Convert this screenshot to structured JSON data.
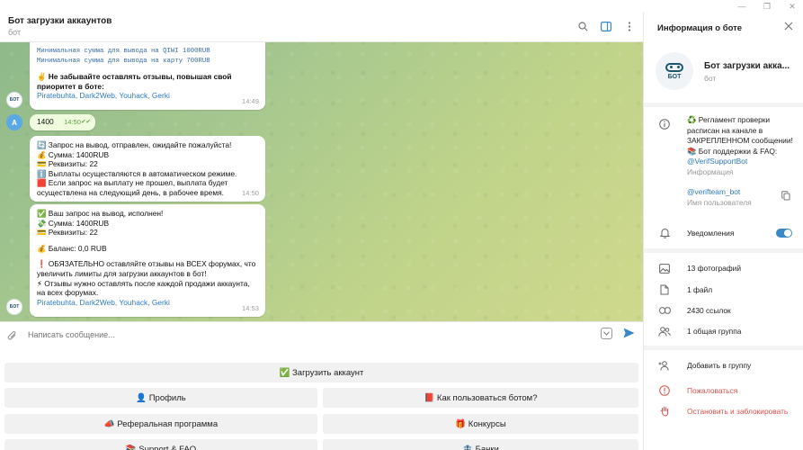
{
  "window": {
    "min": "—",
    "restore": "❐",
    "close": "✕"
  },
  "chat": {
    "title": "Бот загрузки аккаунтов",
    "subtitle": "бот"
  },
  "messages": [
    {
      "id": "m1",
      "lines": [
        {
          "t": "Минимальная сумма для вывода на QIWI 1000RUB",
          "cls": "mono"
        },
        {
          "t": "Минимальная сумма для вывода на карту 700RUB",
          "cls": "mono"
        },
        {
          "t": "",
          "cls": "gap"
        },
        {
          "t": "✌️ Не забывайте оставлять отзывы, повышая свой",
          "cls": "b"
        },
        {
          "t": "приоритет в боте:",
          "cls": "b"
        },
        {
          "t": "Piratebuhta, Dark2Web, Youhack, Gerki",
          "cls": "lnk"
        }
      ],
      "time": "14:49"
    },
    {
      "id": "m2",
      "text": "1400",
      "time": "14:50",
      "check": "✔✔"
    },
    {
      "id": "m3",
      "lines": [
        {
          "t": "🔄 Запрос на вывод,  отправлен, ожидайте пожалуйста!",
          "cls": ""
        },
        {
          "t": "💰 Сумма: 1400RUB",
          "cls": ""
        },
        {
          "t": "💳 Реквизиты: 22",
          "cls": ""
        },
        {
          "t": "ℹ️ Выплаты осуществляются в автоматическом режиме.",
          "cls": ""
        },
        {
          "t": "🟥 Если запрос на выплату не прошел, выплата будет",
          "cls": ""
        },
        {
          "t": "осуществлена на следующий день, в рабочее время.",
          "cls": ""
        }
      ],
      "time": "14:50"
    },
    {
      "id": "m4",
      "lines": [
        {
          "t": "✅ Ваш запрос на вывод, исполнен!",
          "cls": ""
        },
        {
          "t": "💸 Сумма: 1400RUB",
          "cls": ""
        },
        {
          "t": "💳 Реквизиты: 22",
          "cls": ""
        },
        {
          "t": "",
          "cls": "gap"
        },
        {
          "t": "💰 Баланс: 0,0 RUB",
          "cls": ""
        },
        {
          "t": "",
          "cls": "gap"
        },
        {
          "t": "❗ ОБЯЗАТЕЛЬНО оставляйте отзывы на ВСЕХ форумах, что бы",
          "cls": ""
        },
        {
          "t": "увеличить лимиты для загрузки аккаунтов в бот!",
          "cls": ""
        },
        {
          "t": "⚡ Отзывы нужно оставлять после каждой продажи аккаунта,",
          "cls": ""
        },
        {
          "t": "на всех форумах.",
          "cls": ""
        },
        {
          "t": "Piratebuhta, Dark2Web, Youhack, Gerki",
          "cls": "lnk"
        }
      ],
      "time": "14:53"
    }
  ],
  "avatars": {
    "bot": "БОТ",
    "user": "A"
  },
  "composer": {
    "placeholder": "Написать сообщение..."
  },
  "keyboard": {
    "upload": "✅ Загрузить аккаунт",
    "profile": "👤 Профиль",
    "howto": "📕 Как пользоваться ботом?",
    "referral": "📣 Реферальная программа",
    "contests": "🎁 Конкурсы",
    "support": "📚 Support & FAQ",
    "banks": "🏦 Банки"
  },
  "info": {
    "title": "Информация о боте",
    "bot_name": "Бот загрузки акка...",
    "bot_sub": "бот",
    "avatar_text": "БОТ",
    "description": [
      "♻️ Регламент проверки",
      "расписан на канале в",
      "ЗАКРЕПЛЕННОМ сообщении!",
      "📚 Бот поддержки & FAQ:",
      "@VerifSupportBot"
    ],
    "description_label": "Информация",
    "username": "@verifteam_bot",
    "username_label": "Имя пользователя",
    "notifications": "Уведомления",
    "photos": "13 фотографий",
    "files": "1 файл",
    "links": "2430 ссылок",
    "groups": "1 общая группа",
    "add_group": "Добавить в группу",
    "report": "Пожаловаться",
    "block": "Остановить и заблокировать"
  }
}
